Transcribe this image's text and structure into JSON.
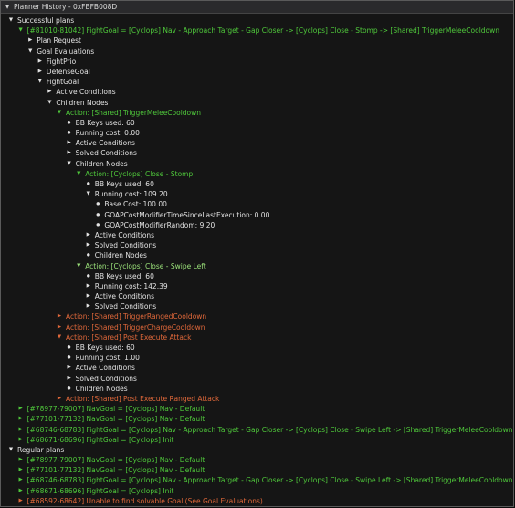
{
  "window": {
    "title": "Planner History - 0xFBFB008D"
  },
  "colors": {
    "white": "#e2e2e2",
    "green": "#4fc83b",
    "light_green": "#9be27a",
    "orange": "#e0683a"
  },
  "tree": [
    {
      "depth": 0,
      "icon": "triangle-down",
      "color": "white",
      "text": "Successful plans"
    },
    {
      "depth": 1,
      "icon": "triangle-down",
      "color": "green",
      "text": "[#81010-81042] FightGoal = [Cyclops] Nav - Approach Target - Gap Closer -> [Cyclops] Close - Stomp -> [Shared] TriggerMeleeCooldown"
    },
    {
      "depth": 2,
      "icon": "triangle-right",
      "color": "white",
      "text": "Plan Request"
    },
    {
      "depth": 2,
      "icon": "triangle-down",
      "color": "white",
      "text": "Goal Evaluations"
    },
    {
      "depth": 3,
      "icon": "triangle-right",
      "color": "white",
      "text": "FightPrio"
    },
    {
      "depth": 3,
      "icon": "triangle-right",
      "color": "white",
      "text": "DefenseGoal"
    },
    {
      "depth": 3,
      "icon": "triangle-down",
      "color": "white",
      "text": "FightGoal"
    },
    {
      "depth": 4,
      "icon": "triangle-right",
      "color": "white",
      "text": "Active Conditions"
    },
    {
      "depth": 4,
      "icon": "triangle-down",
      "color": "white",
      "text": "Children Nodes"
    },
    {
      "depth": 5,
      "icon": "triangle-down",
      "color": "green",
      "text": "Action: [Shared] TriggerMeleeCooldown"
    },
    {
      "depth": 6,
      "icon": "bullet",
      "color": "white",
      "text": "BB Keys used: 60"
    },
    {
      "depth": 6,
      "icon": "bullet",
      "color": "white",
      "text": "Running cost: 0.00"
    },
    {
      "depth": 6,
      "icon": "triangle-right",
      "color": "white",
      "text": "Active Conditions"
    },
    {
      "depth": 6,
      "icon": "triangle-right",
      "color": "white",
      "text": "Solved Conditions"
    },
    {
      "depth": 6,
      "icon": "triangle-down",
      "color": "white",
      "text": "Children Nodes"
    },
    {
      "depth": 7,
      "icon": "triangle-down",
      "color": "green",
      "text": "Action: [Cyclops] Close - Stomp"
    },
    {
      "depth": 8,
      "icon": "bullet",
      "color": "white",
      "text": "BB Keys used: 60"
    },
    {
      "depth": 8,
      "icon": "triangle-down",
      "color": "white",
      "text": "Running cost: 109.20"
    },
    {
      "depth": 9,
      "icon": "bullet",
      "color": "white",
      "text": "Base Cost: 100.00"
    },
    {
      "depth": 9,
      "icon": "bullet",
      "color": "white",
      "text": "GOAPCostModifierTimeSinceLastExecution: 0.00"
    },
    {
      "depth": 9,
      "icon": "bullet",
      "color": "white",
      "text": "GOAPCostModifierRandom: 9.20"
    },
    {
      "depth": 8,
      "icon": "triangle-right",
      "color": "white",
      "text": "Active Conditions"
    },
    {
      "depth": 8,
      "icon": "triangle-right",
      "color": "white",
      "text": "Solved Conditions"
    },
    {
      "depth": 8,
      "icon": "bullet",
      "color": "white",
      "text": "Children Nodes"
    },
    {
      "depth": 7,
      "icon": "triangle-down",
      "color": "lgreen",
      "text": "Action: [Cyclops] Close - Swipe Left"
    },
    {
      "depth": 8,
      "icon": "bullet",
      "color": "white",
      "text": "BB Keys used: 60"
    },
    {
      "depth": 8,
      "icon": "triangle-right",
      "color": "white",
      "text": "Running cost: 142.39"
    },
    {
      "depth": 8,
      "icon": "triangle-right",
      "color": "white",
      "text": "Active Conditions"
    },
    {
      "depth": 8,
      "icon": "triangle-right",
      "color": "white",
      "text": "Solved Conditions"
    },
    {
      "depth": 5,
      "icon": "triangle-right",
      "color": "orange",
      "text": "Action: [Shared] TriggerRangedCooldown"
    },
    {
      "depth": 5,
      "icon": "triangle-right",
      "color": "orange",
      "text": "Action: [Shared] TriggerChargeCooldown"
    },
    {
      "depth": 5,
      "icon": "triangle-down",
      "color": "orange",
      "text": "Action: [Shared] Post Execute Attack"
    },
    {
      "depth": 6,
      "icon": "bullet",
      "color": "white",
      "text": "BB Keys used: 60"
    },
    {
      "depth": 6,
      "icon": "bullet",
      "color": "white",
      "text": "Running cost: 1.00"
    },
    {
      "depth": 6,
      "icon": "triangle-right",
      "color": "white",
      "text": "Active Conditions"
    },
    {
      "depth": 6,
      "icon": "triangle-right",
      "color": "white",
      "text": "Solved Conditions"
    },
    {
      "depth": 6,
      "icon": "bullet",
      "color": "white",
      "text": "Children Nodes"
    },
    {
      "depth": 5,
      "icon": "triangle-right",
      "color": "orange",
      "text": "Action: [Shared] Post Execute Ranged Attack"
    },
    {
      "depth": 1,
      "icon": "triangle-right",
      "color": "green",
      "text": "[#78977-79007] NavGoal = [Cyclops] Nav - Default"
    },
    {
      "depth": 1,
      "icon": "triangle-right",
      "color": "green",
      "text": "[#77101-77132] NavGoal = [Cyclops] Nav - Default"
    },
    {
      "depth": 1,
      "icon": "triangle-right",
      "color": "green",
      "text": "[#68746-68783] FightGoal = [Cyclops] Nav - Approach Target - Gap Closer -> [Cyclops] Close - Swipe Left -> [Shared] TriggerMeleeCooldown"
    },
    {
      "depth": 1,
      "icon": "triangle-right",
      "color": "green",
      "text": "[#68671-68696] FightGoal = [Cyclops] Init"
    },
    {
      "depth": 0,
      "icon": "triangle-down",
      "color": "white",
      "text": "Regular plans"
    },
    {
      "depth": 1,
      "icon": "triangle-right",
      "color": "green",
      "text": "[#78977-79007] NavGoal = [Cyclops] Nav - Default"
    },
    {
      "depth": 1,
      "icon": "triangle-right",
      "color": "green",
      "text": "[#77101-77132] NavGoal = [Cyclops] Nav - Default"
    },
    {
      "depth": 1,
      "icon": "triangle-right",
      "color": "green",
      "text": "[#68746-68783] FightGoal = [Cyclops] Nav - Approach Target - Gap Closer -> [Cyclops] Close - Swipe Left -> [Shared] TriggerMeleeCooldown"
    },
    {
      "depth": 1,
      "icon": "triangle-right",
      "color": "green",
      "text": "[#68671-68696] FightGoal = [Cyclops] Init"
    },
    {
      "depth": 1,
      "icon": "triangle-right",
      "color": "orange",
      "text": "[#68592-68642] Unable to find solvable Goal (See Goal Evaluations)"
    }
  ]
}
